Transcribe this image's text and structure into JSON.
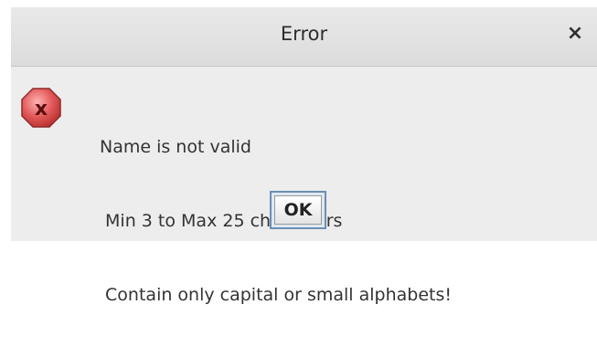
{
  "dialog": {
    "title": "Error",
    "close_glyph": "×",
    "icon": "error-x-octagon-icon",
    "messages": [
      "Name is not valid",
      " Min 3 to Max 25 characters",
      " Contain only capital or small alphabets!"
    ],
    "ok_label": "OK",
    "icon_color": "#e35a5a"
  }
}
